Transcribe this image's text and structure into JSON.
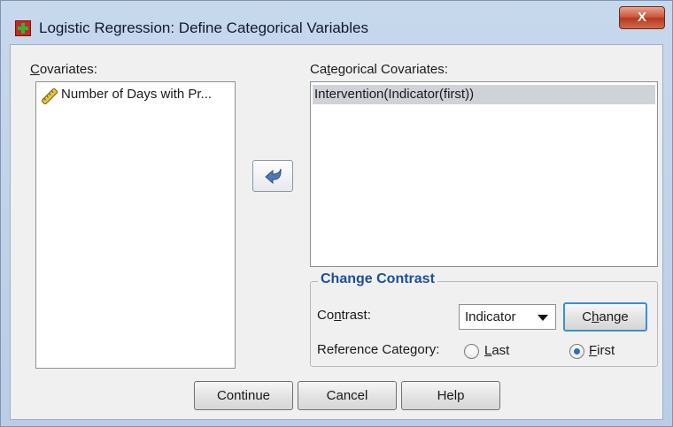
{
  "window": {
    "title": "Logistic Regression: Define Categorical Variables",
    "close_label": "X"
  },
  "covariates": {
    "label_pre": "",
    "label_key": "C",
    "label_post": "ovariates:",
    "items": [
      {
        "label": "Number of Days with Pr...",
        "icon": "scale-ruler-icon"
      }
    ]
  },
  "categorical": {
    "label_pre": "Ca",
    "label_key": "t",
    "label_post": "egorical Covariates:",
    "items": [
      {
        "label": "Intervention(Indicator(first))",
        "selected": true
      }
    ]
  },
  "move_button": {
    "icon": "arrow-left-icon"
  },
  "change_contrast": {
    "title": "Change Contrast",
    "contrast_label_pre": "Co",
    "contrast_label_key": "n",
    "contrast_label_post": "trast:",
    "contrast_value": "Indicator",
    "change_label_pre": "C",
    "change_label_key": "h",
    "change_label_post": "ange",
    "reference_label": "Reference Category:",
    "last_label_pre": "",
    "last_label_key": "L",
    "last_label_post": "ast",
    "first_label_pre": "",
    "first_label_key": "F",
    "first_label_post": "irst",
    "reference_selected": "first"
  },
  "buttons": {
    "continue": "Continue",
    "cancel": "Cancel",
    "help": "Help"
  },
  "colors": {
    "accent": "#1d4f9a",
    "radio_selected": "#2b6fb5",
    "default_button_border": "#3a8fd6"
  }
}
